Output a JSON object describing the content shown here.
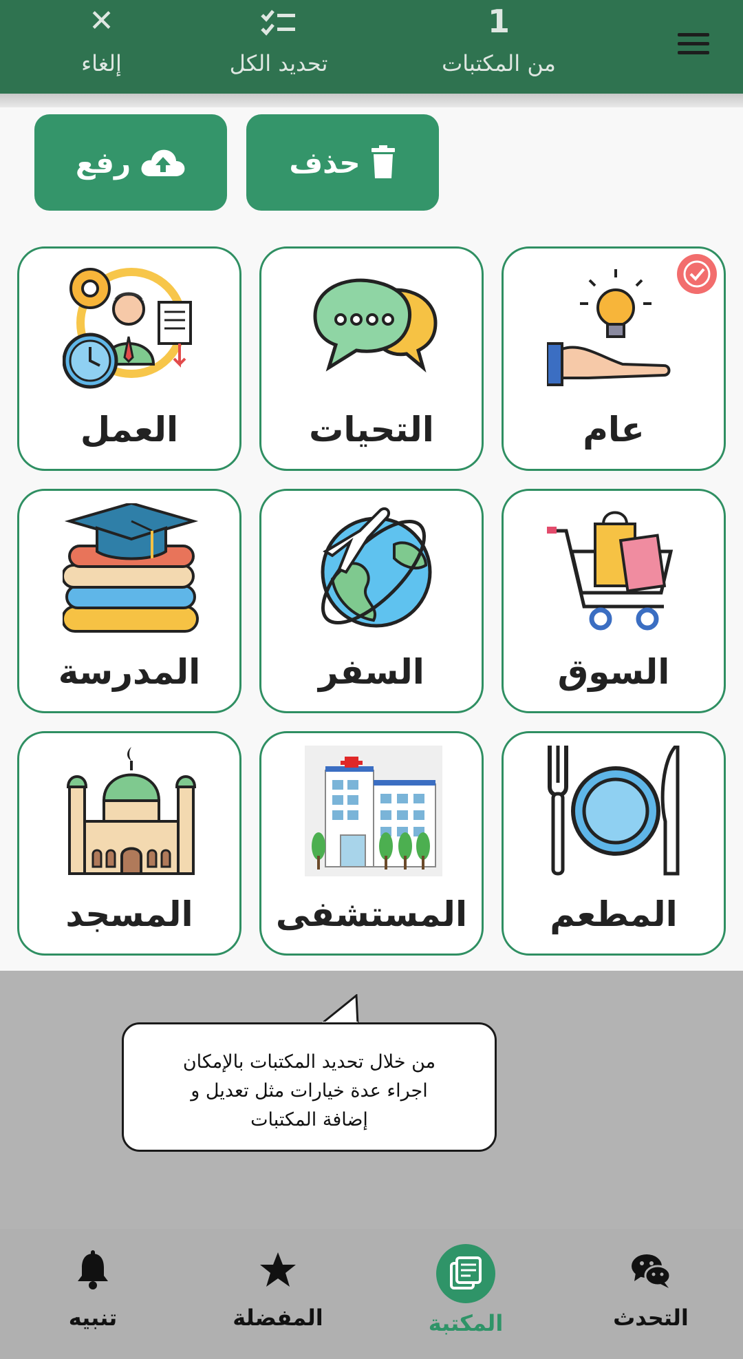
{
  "topbar": {
    "cancel_icon": "close-icon",
    "cancel_label": "إلغاء",
    "select_all_icon": "checklist-icon",
    "select_all_label": "تحديد الكل",
    "selected_count": "1",
    "selected_count_label": "من المكتبات",
    "menu_icon": "hamburger-menu-icon",
    "color": "#2f7350"
  },
  "actions": {
    "upload_label": "رفع",
    "upload_icon": "cloud-upload-icon",
    "delete_label": "حذف",
    "delete_icon": "trash-icon",
    "color": "#34956a"
  },
  "libraries": [
    {
      "name": "عام",
      "icon": "hand-lightbulb-icon",
      "selected": true
    },
    {
      "name": "التحيات",
      "icon": "chat-bubbles-icon",
      "selected": false
    },
    {
      "name": "العمل",
      "icon": "work-icon",
      "selected": false
    },
    {
      "name": "السوق",
      "icon": "shopping-cart-icon",
      "selected": false
    },
    {
      "name": "السفر",
      "icon": "globe-airplane-icon",
      "selected": false
    },
    {
      "name": "المدرسة",
      "icon": "books-graduation-cap-icon",
      "selected": false
    },
    {
      "name": "المطعم",
      "icon": "plate-cutlery-icon",
      "selected": false
    },
    {
      "name": "المستشفى",
      "icon": "hospital-icon",
      "selected": false
    },
    {
      "name": "المسجد",
      "icon": "mosque-icon",
      "selected": false
    }
  ],
  "tooltip": {
    "line1": "من خلال تحديد المكتبات بالإمكان",
    "line2": "اجراء عدة خيارات مثل تعديل و",
    "line3": "إضافة المكتبات"
  },
  "bottomnav": {
    "items": [
      {
        "label": "التحدث",
        "icon": "wechat-icon"
      },
      {
        "label": "المكتبة",
        "icon": "library-icon",
        "active": true
      },
      {
        "label": "المفضلة",
        "icon": "star-icon"
      },
      {
        "label": "تنبيه",
        "icon": "bell-icon"
      }
    ],
    "active_color": "#2f9468"
  }
}
